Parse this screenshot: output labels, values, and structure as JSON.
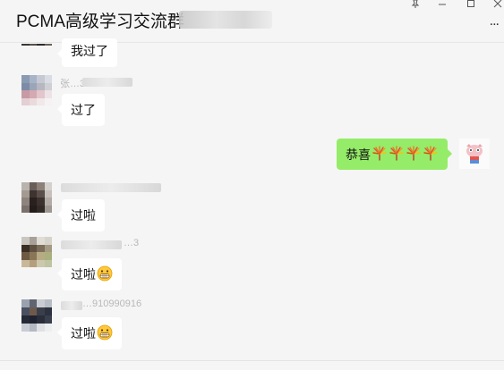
{
  "window": {
    "title": "PCMA高级学习交流群",
    "controls": [
      "pin-icon",
      "minimize-icon",
      "maximize-icon",
      "close-icon"
    ],
    "more_label": "..."
  },
  "messages": [
    {
      "side": "left",
      "text": "我过了"
    },
    {
      "side": "left",
      "sender_visible": "张…3",
      "text": "过了"
    },
    {
      "side": "right",
      "text": "恭喜",
      "emoji_count": 4,
      "emoji": "firework-icon"
    },
    {
      "side": "left",
      "text": "过啦"
    },
    {
      "side": "left",
      "sender_visible": "…3",
      "text": "过啦",
      "emoji": "grin-emoji"
    },
    {
      "side": "left",
      "sender_visible": "…910990916",
      "text": "过啦",
      "emoji": "grin-emoji"
    }
  ],
  "colors": {
    "own_bubble": "#95ec69",
    "other_bubble": "#ffffff",
    "background": "#f5f5f5"
  }
}
